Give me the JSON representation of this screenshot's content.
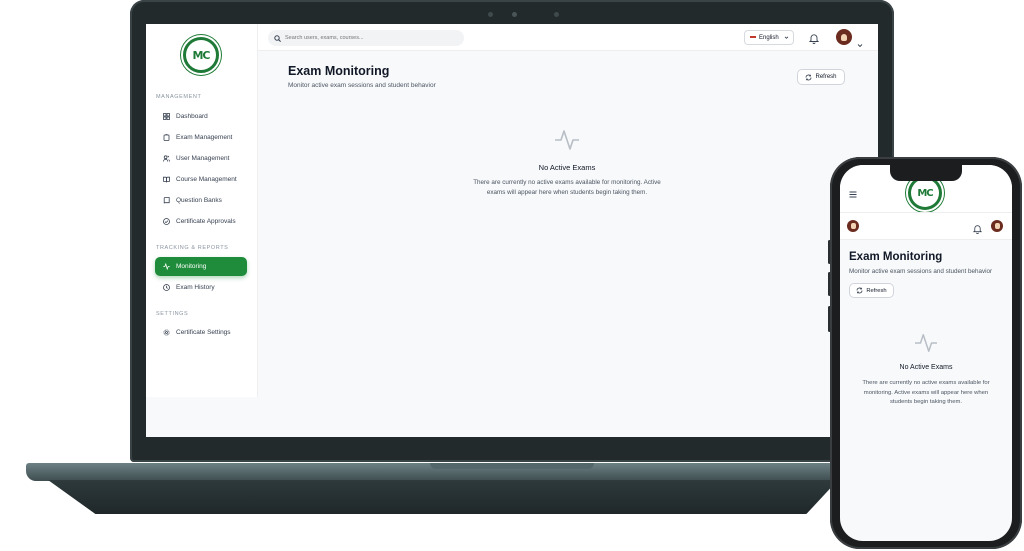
{
  "brand": {
    "logo_text": "MC",
    "accent_color": "#1e8c3a"
  },
  "topbar": {
    "search_placeholder": "Search users, exams, courses...",
    "language": "English",
    "icons": [
      "search-icon",
      "bell-icon",
      "chevron-down-icon"
    ]
  },
  "sidebar": {
    "sections": [
      {
        "title": "MANAGEMENT",
        "items": [
          {
            "label": "Dashboard",
            "icon": "grid-icon"
          },
          {
            "label": "Exam Management",
            "icon": "clipboard-icon"
          },
          {
            "label": "User Management",
            "icon": "users-icon"
          },
          {
            "label": "Course Management",
            "icon": "book-open-icon"
          },
          {
            "label": "Question Banks",
            "icon": "book-icon"
          },
          {
            "label": "Certificate Approvals",
            "icon": "check-circle-icon"
          }
        ]
      },
      {
        "title": "TRACKING & REPORTS",
        "items": [
          {
            "label": "Monitoring",
            "icon": "activity-icon",
            "active": true
          },
          {
            "label": "Exam History",
            "icon": "clock-icon"
          }
        ]
      },
      {
        "title": "SETTINGS",
        "items": [
          {
            "label": "Certificate Settings",
            "icon": "gear-icon"
          }
        ]
      }
    ]
  },
  "main": {
    "title": "Exam Monitoring",
    "subtitle": "Monitor active exam sessions and student behavior",
    "refresh_label": "Refresh",
    "empty_title": "No Active Exams",
    "empty_description": "There are currently no active exams available for monitoring. Active exams will appear here when students begin taking them."
  }
}
